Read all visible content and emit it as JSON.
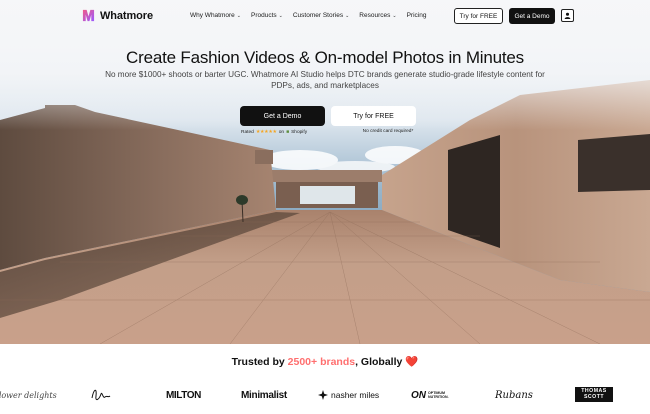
{
  "nav": {
    "logo_text": "Whatmore",
    "menu": [
      {
        "label": "Why Whatmore",
        "has_dropdown": true
      },
      {
        "label": "Products",
        "has_dropdown": true
      },
      {
        "label": "Customer Stories",
        "has_dropdown": true
      },
      {
        "label": "Resources",
        "has_dropdown": true
      },
      {
        "label": "Pricing",
        "has_dropdown": false
      }
    ],
    "try_label": "Try for FREE",
    "demo_label": "Get a Demo",
    "user_icon": "user-icon"
  },
  "hero": {
    "headline": "Create Fashion Videos & On-model Photos in Minutes",
    "subhead": "No more $1000+ shoots or barter UGC. Whatmore AI Studio helps DTC brands generate studio-grade lifestyle content for PDPs, ads, and marketplaces",
    "cta_demo": "Get a Demo",
    "cta_try": "Try for FREE",
    "rating_prefix": "Rated",
    "rating_stars": "★★★★★",
    "rating_suffix": "on",
    "rating_platform": "Shopify",
    "no_card": "No credit card required*"
  },
  "trusted": {
    "prefix": "Trusted by ",
    "count": "2500+ brands",
    "suffix": ", Globally ",
    "heart": "❤️"
  },
  "brands": {
    "flower": "flower delights",
    "milton": "MILTON",
    "minimalist": "Minimalist",
    "nasher": "nasher miles",
    "on": "ON",
    "on_sub_1": "OPTIMUM",
    "on_sub_2": "NUTRITION.",
    "rubans": "Rubans",
    "thomas_1": "THOMAS",
    "thomas_2": "SCOTT"
  },
  "colors": {
    "accent": "#ff6f6f",
    "primary_button": "#111111",
    "logo_gradient_start": "#f05a8a",
    "logo_gradient_end": "#9b59ff"
  }
}
